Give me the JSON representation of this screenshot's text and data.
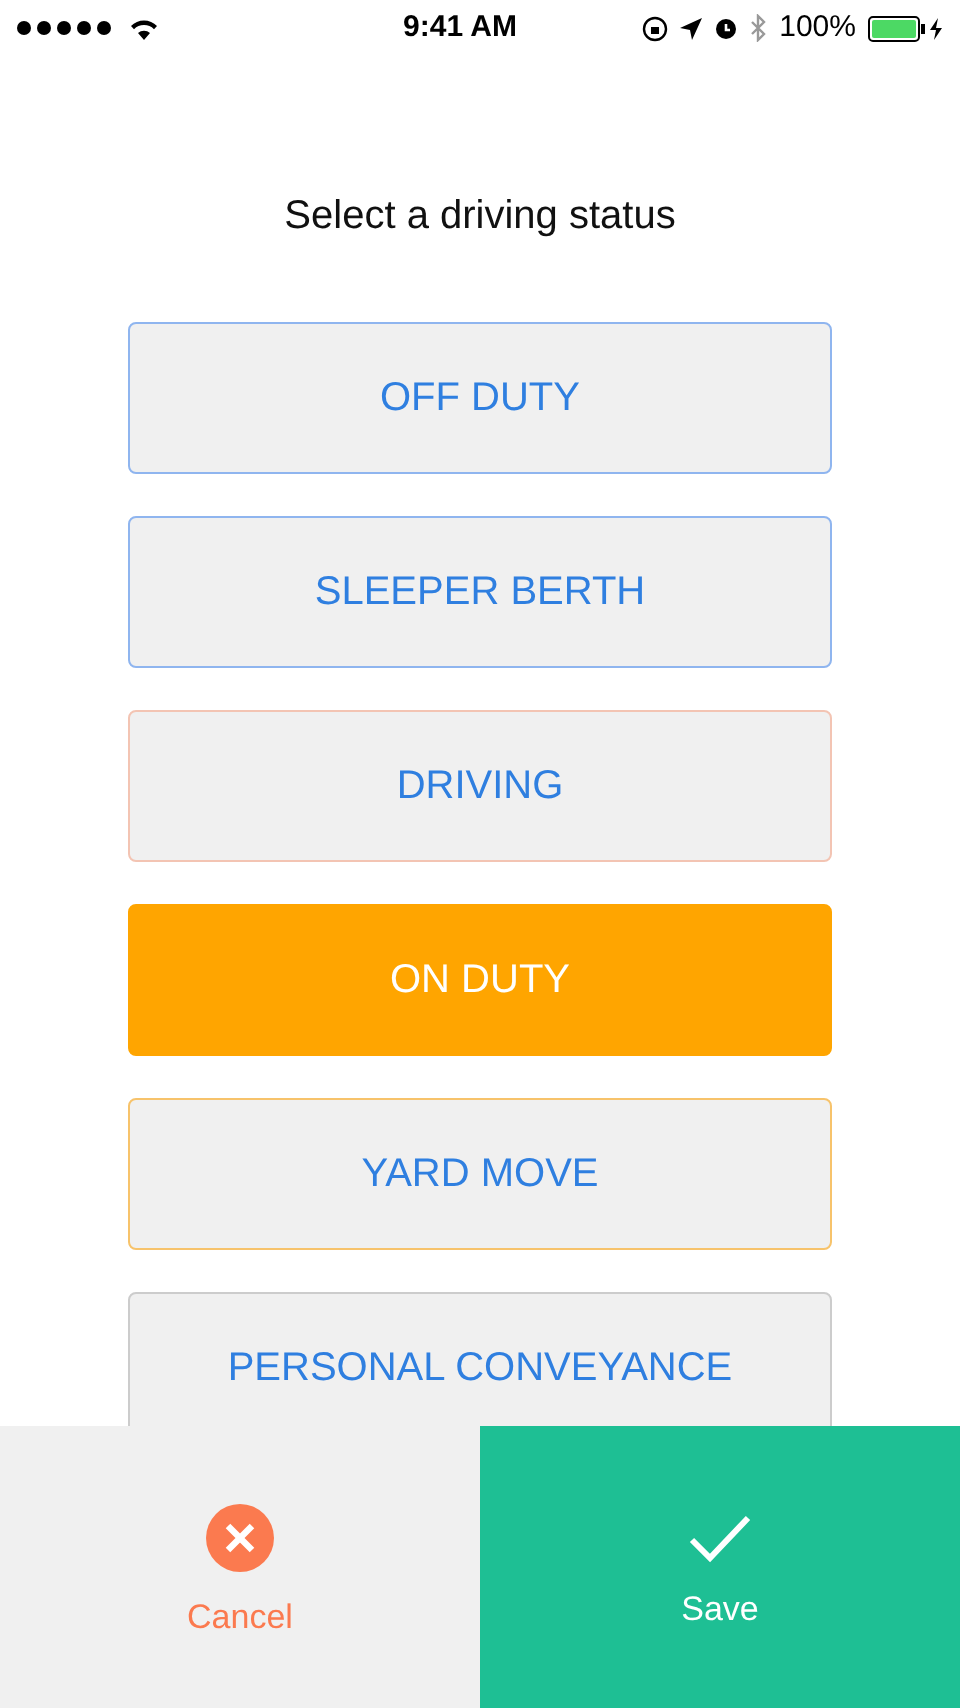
{
  "status_bar": {
    "time": "9:41 AM",
    "battery": "100%"
  },
  "title": "Select a driving status",
  "options": [
    {
      "label": "OFF DUTY",
      "selected": false,
      "color": "#8fb5ef"
    },
    {
      "label": "SLEEPER BERTH",
      "selected": false,
      "color": "#8fb5ef"
    },
    {
      "label": "DRIVING",
      "selected": false,
      "color": "#f3c4b3"
    },
    {
      "label": "ON DUTY",
      "selected": true,
      "color": "#ffa500"
    },
    {
      "label": "YARD MOVE",
      "selected": false,
      "color": "#f7c36b"
    },
    {
      "label": "PERSONAL CONVEYANCE",
      "selected": false,
      "color": "#cccccc"
    }
  ],
  "actions": [
    {
      "kind": "cancel",
      "label": "Cancel"
    },
    {
      "kind": "save",
      "label": "Save"
    }
  ]
}
